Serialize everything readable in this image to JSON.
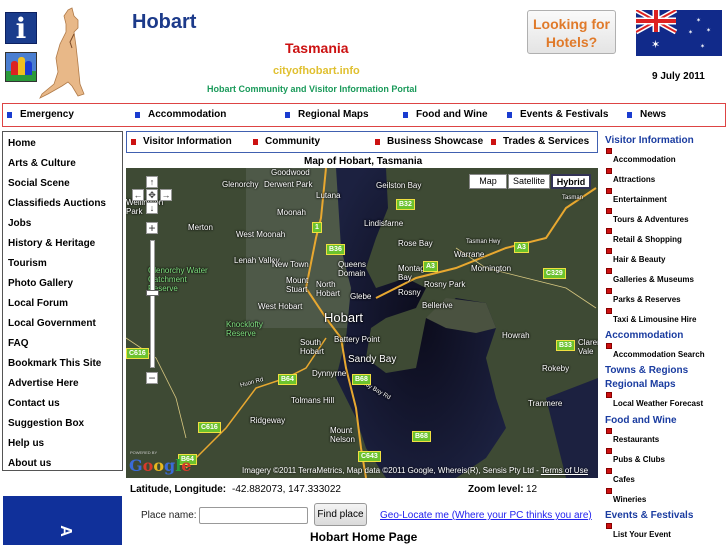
{
  "header": {
    "site_title": "Hobart",
    "region": "Tasmania",
    "domain": "cityofhobart.info",
    "tagline": "Hobart Community and Visitor Information Portal",
    "hotel_button": [
      "Looking for",
      "Hotels?"
    ],
    "date": "9 July 2011",
    "icons": [
      "info-icon",
      "people-icon",
      "kangaroo-logo",
      "australian-flag"
    ]
  },
  "top_nav": [
    {
      "label": "Emergency"
    },
    {
      "label": "Accommodation"
    },
    {
      "label": "Regional Maps"
    },
    {
      "label": "Food and Wine"
    },
    {
      "label": "Events & Festivals"
    },
    {
      "label": "News"
    }
  ],
  "left_nav": [
    "Home",
    "Arts & Culture",
    "Social Scene",
    "Classifieds Auctions",
    "Jobs",
    "History & Heritage",
    "Tourism",
    "Photo Gallery",
    "Local Forum",
    "Local Government",
    "FAQ",
    "Bookmark This Site",
    "Advertise Here",
    "Contact us",
    "Suggestion Box",
    "Help us",
    "About us"
  ],
  "ad_banner_text": "A",
  "sub_nav": [
    {
      "label": "Visitor Information"
    },
    {
      "label": "Community"
    },
    {
      "label": "Business Showcase"
    },
    {
      "label": "Trades & Services"
    }
  ],
  "map": {
    "title": "Map of Hobart, Tasmania",
    "types": [
      "Map",
      "Satellite",
      "Hybrid"
    ],
    "active_type": "Hybrid",
    "pan_controls": {
      "up": "↑",
      "left": "←",
      "center": "✥",
      "right": "→",
      "down": "↓"
    },
    "zoom_in": "+",
    "zoom_out": "−",
    "places": [
      "Goodwood",
      "Glenorchy",
      "Derwent Park",
      "Lutana",
      "Geilston Bay",
      "Moonah",
      "Lindisfarne",
      "Merton",
      "West Moonah",
      "Rose Bay",
      "Warrane",
      "Tasman Hwy",
      "Mornington",
      "Lenah Valley",
      "New Town",
      "Queens Domain",
      "Montagu Bay",
      "Rosny Park",
      "Rosny",
      "Mount Stuart",
      "North Hobart",
      "Glebe",
      "Bellerive",
      "West Hobart",
      "Hobart",
      "Knocklofty Reserve",
      "Glenorchy Water Catchment Reserve",
      "Battery Point",
      "South Hobart",
      "Sandy Bay",
      "Howrah",
      "Dynnyrne",
      "Huon Rd",
      "Sandy Bay Rd",
      "Rokeby",
      "Tolmans Hill",
      "Ridgeway",
      "Tranmere",
      "Mount Nelson",
      "Wellington Park",
      "Tasman",
      "Clarendon Vale"
    ],
    "road_shields": [
      "1",
      "B32",
      "B36",
      "A3",
      "A3",
      "C329",
      "B33",
      "C616",
      "C616",
      "B64",
      "B64",
      "B68",
      "B68",
      "C643"
    ],
    "powered_by": "POWERED BY",
    "google_logo": "Google",
    "copyright": "Imagery ©2011 TerraMetrics, Map data ©2011 Google, Whereis(R), Sensis Pty Ltd - ",
    "terms_link": "Terms of Use"
  },
  "coords": {
    "latlng_label": "Latitude, Longitude:",
    "latlng_value": "-42.882073, 147.333022",
    "zoom_label": "Zoom level:",
    "zoom_value": "12"
  },
  "search": {
    "place_label": "Place name:",
    "place_value": "",
    "find_button": "Find place",
    "geo_link": "Geo-Locate me (Where your PC thinks you are)"
  },
  "home_heading": "Hobart Home Page",
  "right_sidebar": [
    {
      "heading": "Visitor Information",
      "items": [
        "Accommodation",
        "Attractions",
        "Entertainment",
        "Tours & Adventures",
        "Retail & Shopping",
        "Hair & Beauty",
        "Galleries & Museums",
        "Parks & Reserves",
        "Taxi & Limousine Hire"
      ]
    },
    {
      "heading": "Accommodation",
      "items": [
        "Accommodation Search"
      ]
    },
    {
      "heading": "Towns & Regions",
      "items": []
    },
    {
      "heading": "Regional Maps",
      "items": [
        "Local Weather Forecast"
      ]
    },
    {
      "heading": "Food and Wine",
      "items": [
        "Restaurants",
        "Pubs & Clubs",
        "Cafes",
        "Wineries"
      ]
    },
    {
      "heading": "Events & Festivals",
      "items": [
        "List Your Event"
      ]
    }
  ]
}
